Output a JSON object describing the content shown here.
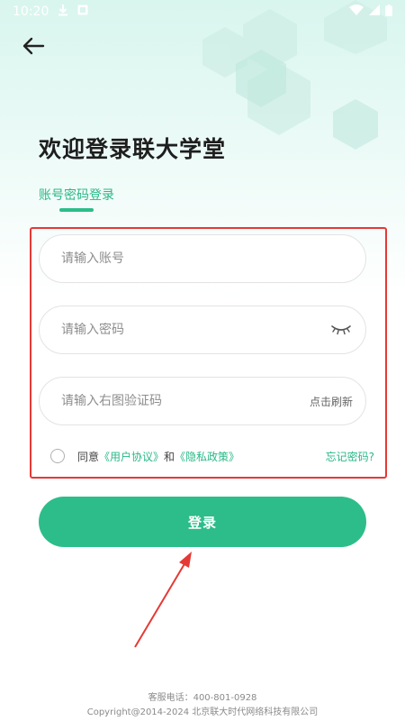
{
  "status_bar": {
    "time": "10:20",
    "download_icon": "download-icon",
    "notification_icon": "notification-icon",
    "wifi_icon": "wifi-icon",
    "signal_icon": "signal-icon",
    "battery_icon": "battery-icon"
  },
  "header": {
    "back_icon": "arrow-left-icon",
    "title": "欢迎登录联大学堂"
  },
  "tabs": [
    {
      "label": "账号密码登录",
      "active": true
    }
  ],
  "form": {
    "account": {
      "placeholder": "请输入账号",
      "value": ""
    },
    "password": {
      "placeholder": "请输入密码",
      "value": "",
      "toggle_icon": "eye-closed-icon"
    },
    "captcha": {
      "placeholder": "请输入右图验证码",
      "value": "",
      "refresh_label": "点击刷新"
    }
  },
  "agreement": {
    "checked": false,
    "prefix": "同意",
    "user_agreement": "《用户协议》",
    "and": "和",
    "privacy_policy": "《隐私政策》",
    "forgot_password": "忘记密码?"
  },
  "login_button": {
    "label": "登录"
  },
  "footer": {
    "phone": "客服电话：400-801-0928",
    "copyright": "Copyright@2014-2024 北京联大时代网络科技有限公司"
  },
  "colors": {
    "accent": "#2dbd8a",
    "link": "#29b886",
    "annotation_red": "#e53935"
  }
}
